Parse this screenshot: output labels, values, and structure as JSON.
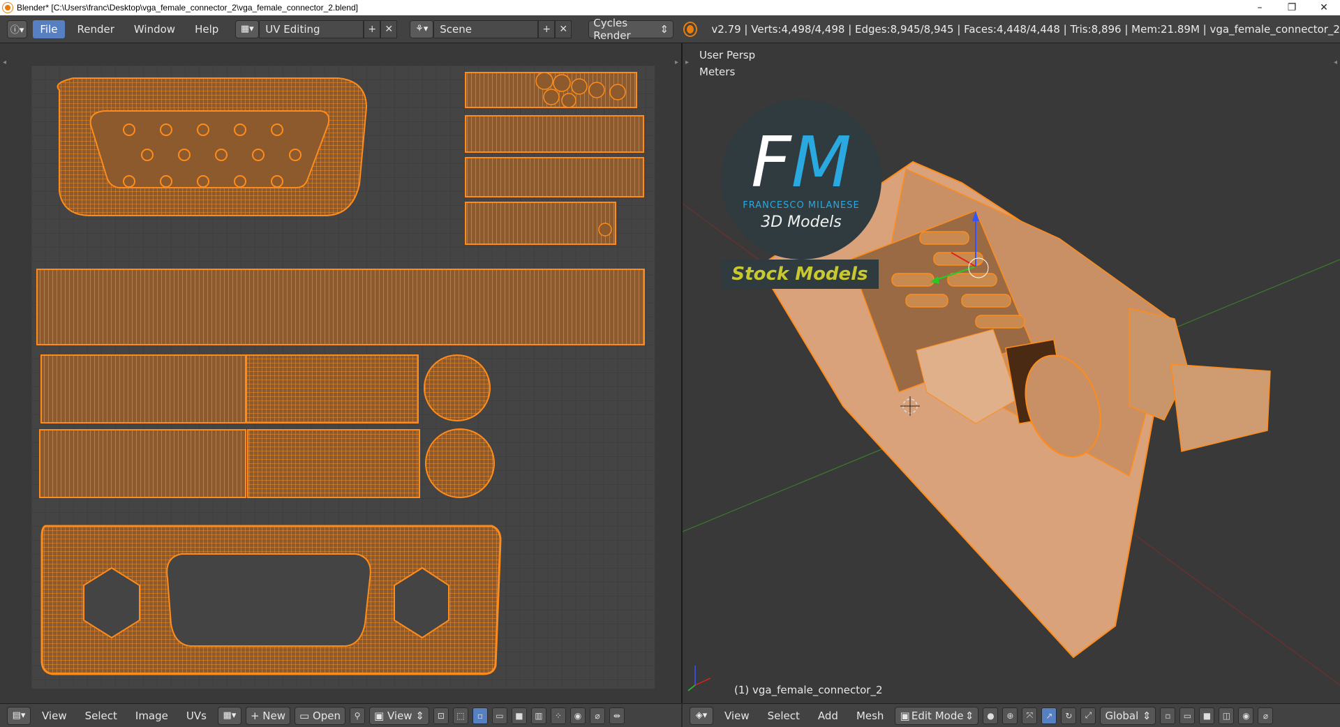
{
  "window": {
    "title": "Blender* [C:\\Users\\franc\\Desktop\\vga_female_connector_2\\vga_female_connector_2.blend]",
    "minimize": "–",
    "restore": "❐",
    "close": "✕"
  },
  "topbar": {
    "menus": [
      "File",
      "Render",
      "Window",
      "Help"
    ],
    "screen_layout": "UV Editing",
    "scene": "Scene",
    "render_engine": "Cycles Render",
    "stats": "v2.79 | Verts:4,498/4,498 | Edges:8,945/8,945 | Faces:4,448/4,448 | Tris:8,896 | Mem:21.89M | vga_female_connector_2"
  },
  "viewport": {
    "view_name": "User Persp",
    "units": "Meters",
    "object_label": "(1) vga_female_connector_2"
  },
  "logo": {
    "f": "F",
    "m": "M",
    "name": "FRANCESCO MILANESE",
    "tagline": "3D Models",
    "banner": "Stock Models"
  },
  "uv_bottombar": {
    "menus": [
      "View",
      "Select",
      "Image",
      "UVs"
    ],
    "new_label": "New",
    "open_label": "Open",
    "view_label": "View"
  },
  "view3d_bottombar": {
    "menus": [
      "View",
      "Select",
      "Add",
      "Mesh"
    ],
    "mode": "Edit Mode",
    "orientation": "Global"
  },
  "colors": {
    "accent": "#5680c2",
    "selection": "#ff8c1a",
    "mesh_face": "#8c5a2c",
    "background": "#393939"
  }
}
